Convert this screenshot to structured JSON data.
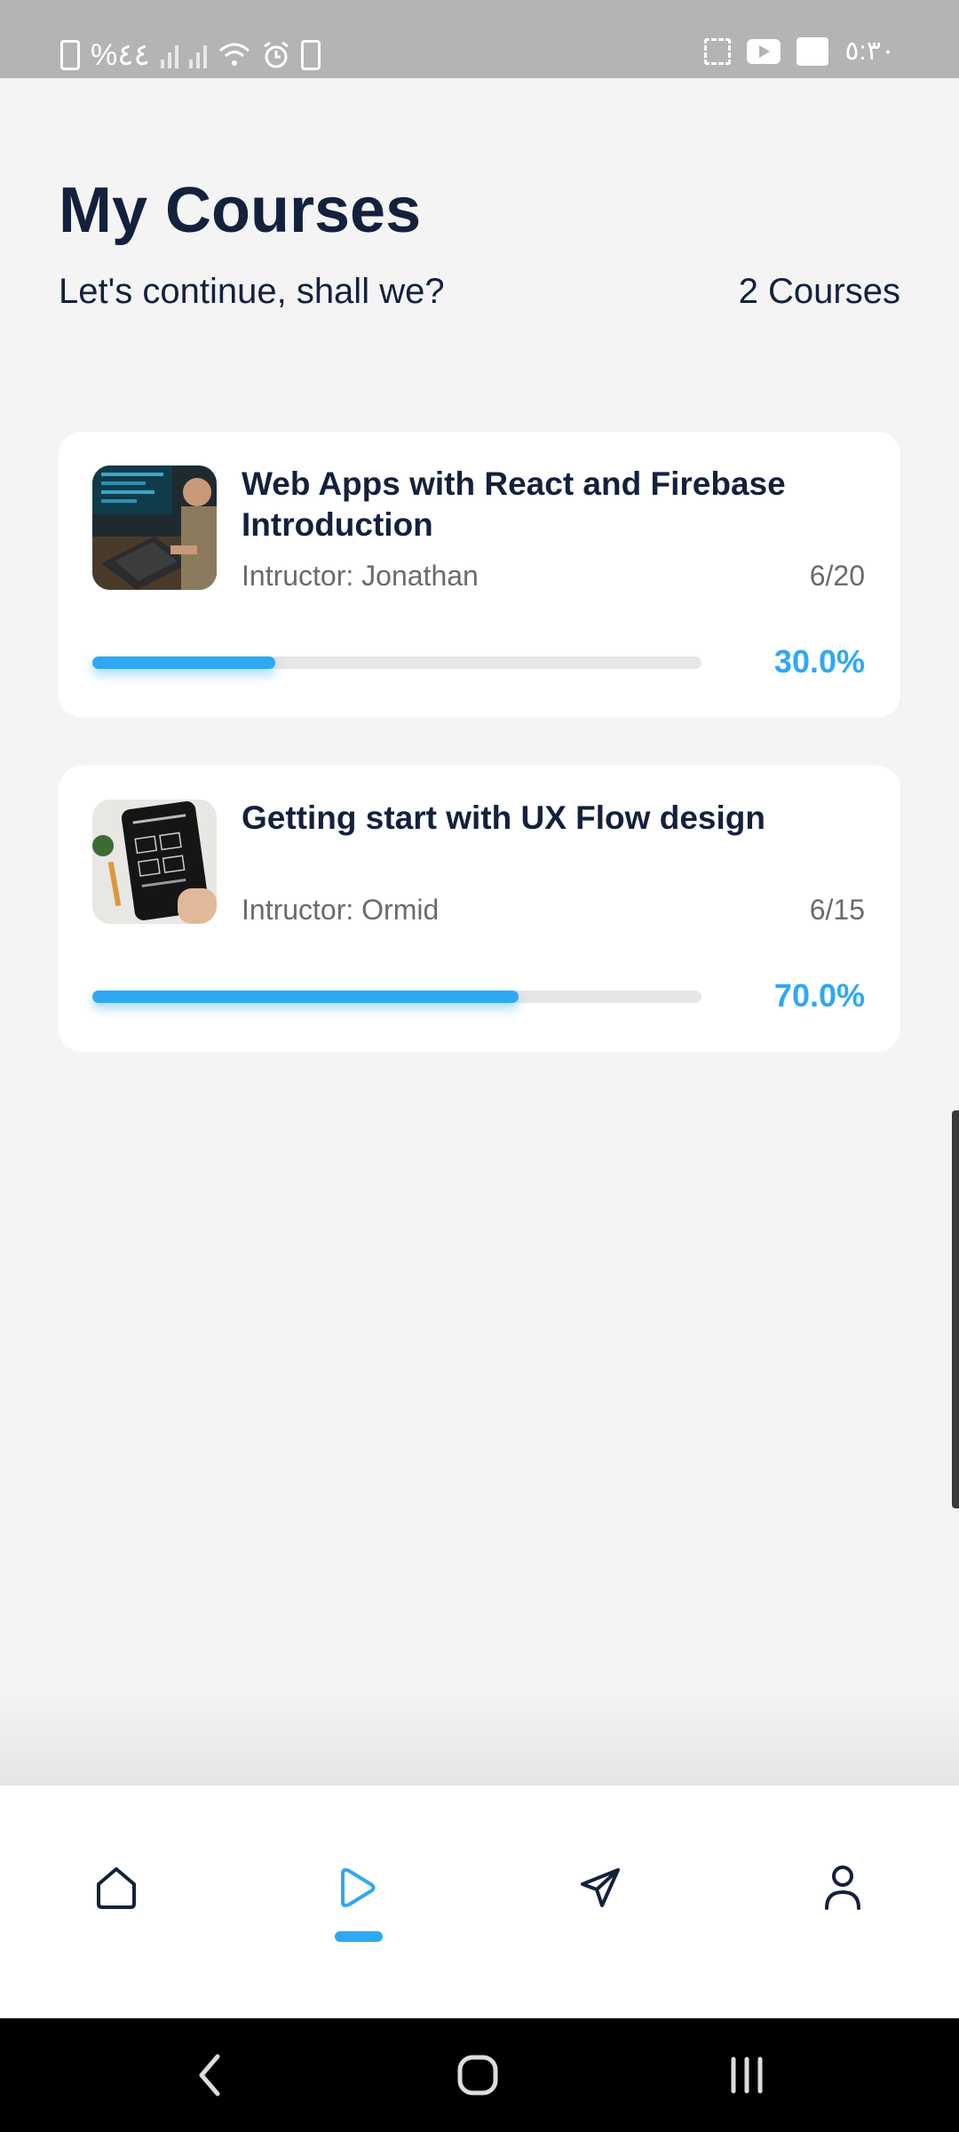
{
  "status_bar": {
    "battery_text": "%٤٤",
    "time": "٥:٣٠"
  },
  "header": {
    "title": "My Courses",
    "subtitle": "Let's continue, shall we?",
    "course_count": "2 Courses"
  },
  "courses": [
    {
      "title": "Web Apps with React and Firebase Introduction",
      "instructor": "Intructor: Jonathan",
      "lessons": "6/20",
      "progress_label": "30.0%",
      "progress": 0.3,
      "thumbnail": "developer-at-laptop-photo"
    },
    {
      "title": "Getting start with UX Flow design",
      "instructor": "Intructor: Ormid",
      "lessons": "6/15",
      "progress_label": "70.0%",
      "progress": 0.7,
      "thumbnail": "tablet-wireframe-photo"
    }
  ],
  "bottom_nav": {
    "items": [
      {
        "icon": "home-icon",
        "active": false
      },
      {
        "icon": "play-icon",
        "active": true
      },
      {
        "icon": "rocket-icon",
        "active": false
      },
      {
        "icon": "profile-icon",
        "active": false
      }
    ],
    "accent_color": "#2fa8f4",
    "inactive_color": "#14213d"
  },
  "system_nav": {
    "buttons": [
      "back-icon",
      "home-circle-icon",
      "recents-icon"
    ]
  }
}
